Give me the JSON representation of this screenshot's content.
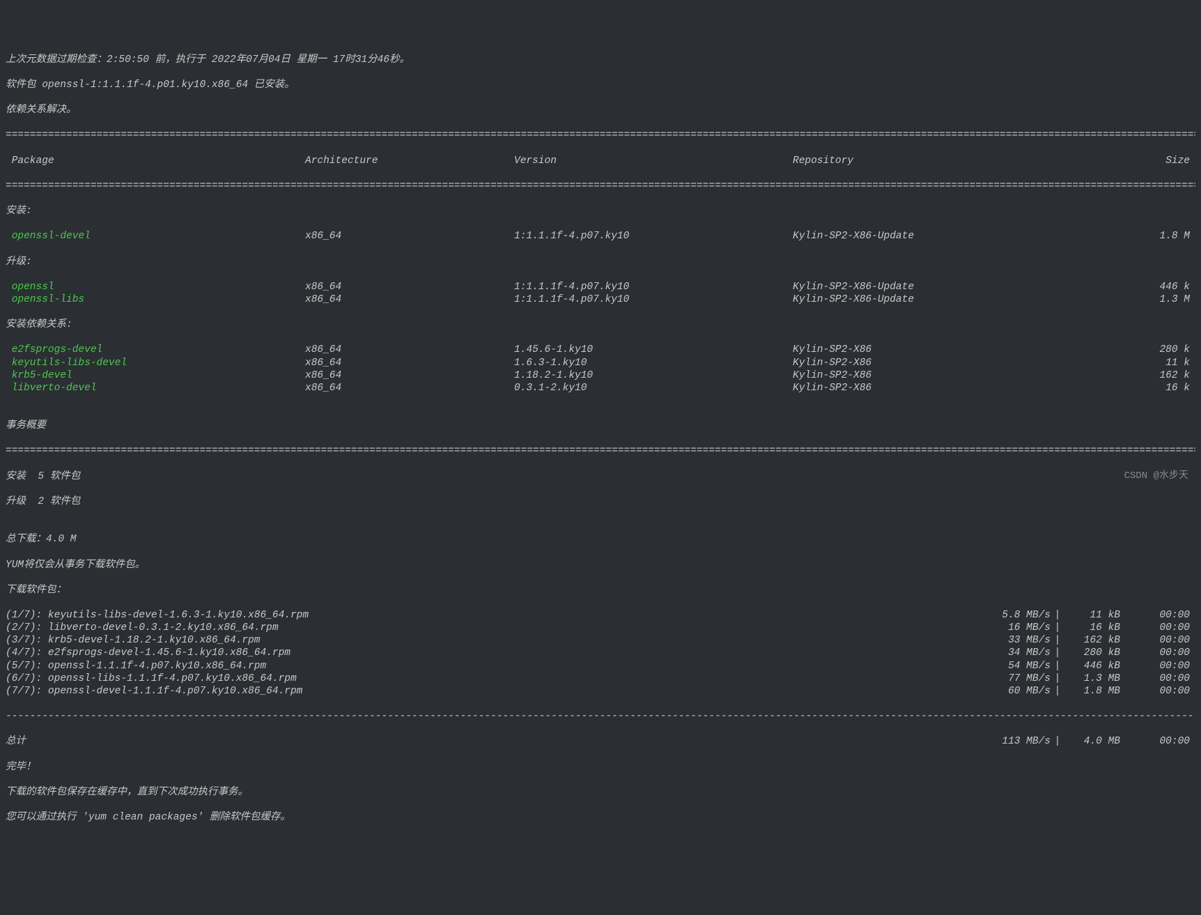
{
  "header": {
    "line1": "上次元数据过期检查：2:50:50 前，执行于 2022年07月04日 星期一 17时31分46秒。",
    "line2": "软件包 openssl-1:1.1.1f-4.p01.ky10.x86_64 已安装。",
    "line3": "依赖关系解决。"
  },
  "columns": {
    "pkg": " Package",
    "arch": "Architecture",
    "ver": "Version",
    "repo": "Repository",
    "size": "Size"
  },
  "sections": {
    "install": "安装:",
    "upgrade": "升级:",
    "installdep": "安装依赖关系:",
    "summary": "事务概要"
  },
  "install": [
    {
      "name": " openssl-devel",
      "arch": "x86_64",
      "ver": "1:1.1.1f-4.p07.ky10",
      "repo": "Kylin-SP2-X86-Update",
      "size": "1.8 M"
    }
  ],
  "upgrade": [
    {
      "name": " openssl",
      "arch": "x86_64",
      "ver": "1:1.1.1f-4.p07.ky10",
      "repo": "Kylin-SP2-X86-Update",
      "size": "446 k"
    },
    {
      "name": " openssl-libs",
      "arch": "x86_64",
      "ver": "1:1.1.1f-4.p07.ky10",
      "repo": "Kylin-SP2-X86-Update",
      "size": "1.3 M"
    }
  ],
  "installdep": [
    {
      "name": " e2fsprogs-devel",
      "arch": "x86_64",
      "ver": "1.45.6-1.ky10",
      "repo": "Kylin-SP2-X86",
      "size": "280 k"
    },
    {
      "name": " keyutils-libs-devel",
      "arch": "x86_64",
      "ver": "1.6.3-1.ky10",
      "repo": "Kylin-SP2-X86",
      "size": "11 k"
    },
    {
      "name": " krb5-devel",
      "arch": "x86_64",
      "ver": "1.18.2-1.ky10",
      "repo": "Kylin-SP2-X86",
      "size": "162 k"
    },
    {
      "name": " libverto-devel",
      "arch": "x86_64",
      "ver": "0.3.1-2.ky10",
      "repo": "Kylin-SP2-X86",
      "size": "16 k"
    }
  ],
  "summary": {
    "install_count": "安装  5 软件包",
    "upgrade_count": "升级  2 软件包",
    "blank": "",
    "total_dl": "总下载：4.0 M",
    "yum_note": "YUM将仅会从事务下载软件包。",
    "dl_header": "下载软件包："
  },
  "downloads": [
    {
      "name": "(1/7): keyutils-libs-devel-1.6.3-1.ky10.x86_64.rpm",
      "speed": "5.8 MB/s",
      "size": " 11 kB",
      "time": "00:00"
    },
    {
      "name": "(2/7): libverto-devel-0.3.1-2.ky10.x86_64.rpm",
      "speed": "16 MB/s",
      "size": " 16 kB",
      "time": "00:00"
    },
    {
      "name": "(3/7): krb5-devel-1.18.2-1.ky10.x86_64.rpm",
      "speed": "33 MB/s",
      "size": "162 kB",
      "time": "00:00"
    },
    {
      "name": "(4/7): e2fsprogs-devel-1.45.6-1.ky10.x86_64.rpm",
      "speed": "34 MB/s",
      "size": "280 kB",
      "time": "00:00"
    },
    {
      "name": "(5/7): openssl-1.1.1f-4.p07.ky10.x86_64.rpm",
      "speed": "54 MB/s",
      "size": "446 kB",
      "time": "00:00"
    },
    {
      "name": "(6/7): openssl-libs-1.1.1f-4.p07.ky10.x86_64.rpm",
      "speed": "77 MB/s",
      "size": "1.3 MB",
      "time": "00:00"
    },
    {
      "name": "(7/7): openssl-devel-1.1.1f-4.p07.ky10.x86_64.rpm",
      "speed": "60 MB/s",
      "size": "1.8 MB",
      "time": "00:00"
    }
  ],
  "total": {
    "name": "总计",
    "speed": "113 MB/s",
    "size": "4.0 MB",
    "time": "00:00"
  },
  "footer": {
    "done": "完毕！",
    "cache_note": "下载的软件包保存在缓存中，直到下次成功执行事务。",
    "clean_note": "您可以通过执行 'yum clean packages' 删除软件包缓存。"
  },
  "sep": "|",
  "hr": "================================================================================================================================================================================================================================================",
  "dash": "------------------------------------------------------------------------------------------------------------------------------------------------------------------------------------------------------------------------------------------------",
  "watermark": "CSDN @水步天"
}
